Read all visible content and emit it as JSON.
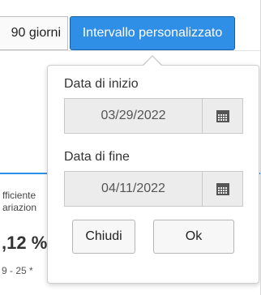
{
  "toolbar": {
    "range_90_label": "90 giorni",
    "custom_range_label": "Intervallo personalizzato"
  },
  "background": {
    "label_line1": "fficiente",
    "label_line2": "ariazion",
    "value": ",12 %",
    "range": "9 - 25 *"
  },
  "date_picker": {
    "start_label": "Data di inizio",
    "start_value": "03/29/2022",
    "end_label": "Data di fine",
    "end_value": "04/11/2022",
    "close_label": "Chiudi",
    "ok_label": "Ok"
  },
  "colors": {
    "accent": "#2f8fe6",
    "field_bg": "#ececec"
  }
}
